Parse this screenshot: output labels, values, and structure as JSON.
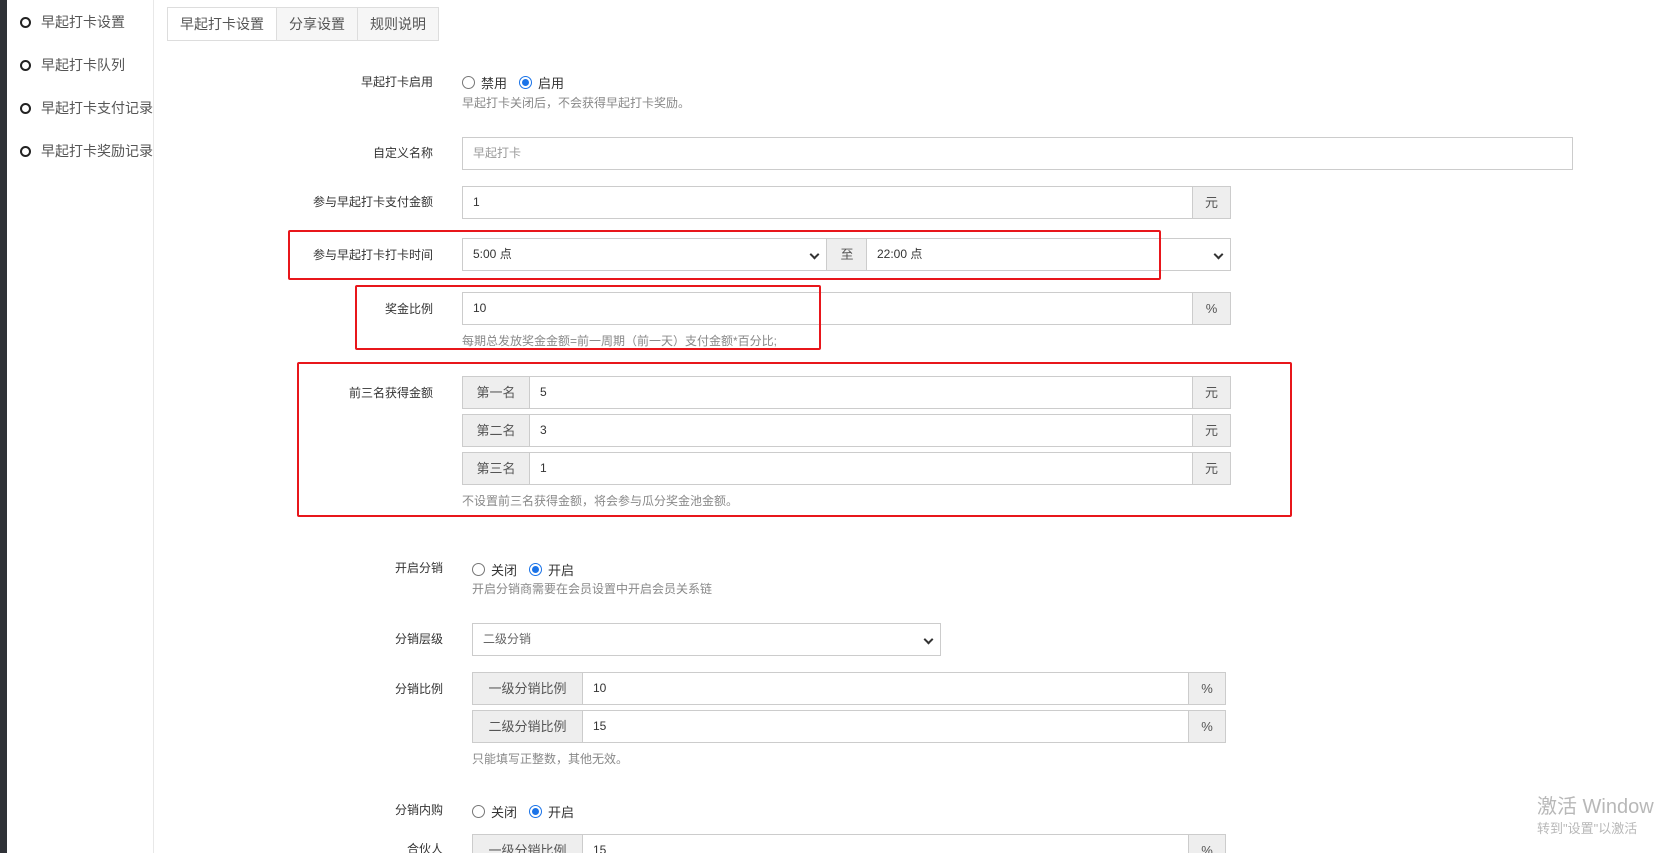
{
  "sidebar": {
    "items": [
      {
        "label": "早起打卡设置"
      },
      {
        "label": "早起打卡队列"
      },
      {
        "label": "早起打卡支付记录"
      },
      {
        "label": "早起打卡奖励记录"
      }
    ]
  },
  "tabs": [
    {
      "label": "早起打卡设置",
      "active": true
    },
    {
      "label": "分享设置",
      "active": false
    },
    {
      "label": "规则说明",
      "active": false
    }
  ],
  "form": {
    "enable": {
      "label": "早起打卡启用",
      "options": [
        {
          "label": "禁用",
          "selected": false
        },
        {
          "label": "启用",
          "selected": true
        }
      ],
      "hint": "早起打卡关闭后，不会获得早起打卡奖励。"
    },
    "custom_name": {
      "label": "自定义名称",
      "placeholder": "早起打卡"
    },
    "pay_amount": {
      "label": "参与早起打卡支付金额",
      "value": "1",
      "unit": "元"
    },
    "checkin_time": {
      "label": "参与早起打卡打卡时间",
      "start": "5:00 点",
      "separator": "至",
      "end": "22:00 点"
    },
    "bonus_ratio": {
      "label": "奖金比例",
      "value": "10",
      "unit": "%",
      "hint": "每期总发放奖金金额=前一周期（前一天）支付金额*百分比;"
    },
    "top_three": {
      "label": "前三名获得金额",
      "rows": [
        {
          "name": "第一名",
          "value": "5",
          "unit": "元"
        },
        {
          "name": "第二名",
          "value": "3",
          "unit": "元"
        },
        {
          "name": "第三名",
          "value": "1",
          "unit": "元"
        }
      ],
      "hint": "不设置前三名获得金额，将会参与瓜分奖金池金额。"
    },
    "distribution": {
      "label": "开启分销",
      "options": [
        {
          "label": "关闭",
          "selected": false
        },
        {
          "label": "开启",
          "selected": true
        }
      ],
      "hint": "开启分销商需要在会员设置中开启会员关系链"
    },
    "distribution_level": {
      "label": "分销层级",
      "value": "二级分销"
    },
    "distribution_ratio": {
      "label": "分销比例",
      "rows": [
        {
          "name": "一级分销比例",
          "value": "10",
          "unit": "%"
        },
        {
          "name": "二级分销比例",
          "value": "15",
          "unit": "%"
        }
      ],
      "hint": "只能填写正整数，其他无效。"
    },
    "inner_purchase": {
      "label": "分销内购",
      "options": [
        {
          "label": "关闭",
          "selected": false
        },
        {
          "label": "开启",
          "selected": true
        }
      ]
    },
    "partner": {
      "label": "合伙人",
      "rows": [
        {
          "name": "一级分销比例",
          "value": "15",
          "unit": "%"
        }
      ]
    }
  },
  "watermark": {
    "line1": "激活 Window",
    "line2": "转到\"设置\"以激活"
  },
  "colors": {
    "highlight_box": "#e8161b",
    "radio_selected": "#1a73e8",
    "left_strip": "#2f3237"
  }
}
